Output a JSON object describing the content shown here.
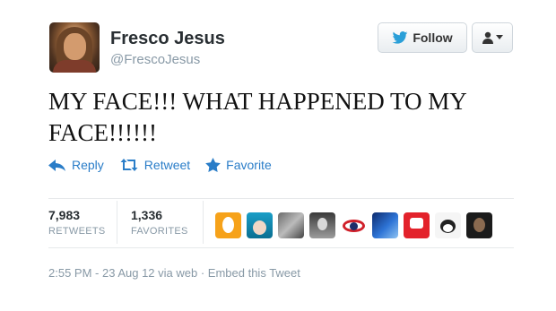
{
  "author": {
    "display_name": "Fresco Jesus",
    "username": "@FrescoJesus"
  },
  "follow_button": {
    "label": "Follow",
    "icon": "twitter-bird-icon"
  },
  "user_menu": {
    "icon": "user-icon"
  },
  "tweet": {
    "line1": "MY FACE!!! WHAT HAPPENED TO MY",
    "line2": "FACE!!!!!!"
  },
  "actions": {
    "reply": "Reply",
    "retweet": "Retweet",
    "favorite": "Favorite"
  },
  "stats": {
    "retweets": {
      "count": "7,983",
      "label": "RETWEETS"
    },
    "favorites": {
      "count": "1,336",
      "label": "FAVORITES"
    }
  },
  "favoriter_avatars": [
    {
      "icon": "egg-avatar"
    },
    {
      "icon": "anime-girl-avatar"
    },
    {
      "icon": "wolf-avatar"
    },
    {
      "icon": "portrait-avatar"
    },
    {
      "icon": "eye-avatar"
    },
    {
      "icon": "blue-abstract-avatar"
    },
    {
      "icon": "red-character-avatar"
    },
    {
      "icon": "cat-avatar"
    },
    {
      "icon": "dark-face-avatar"
    }
  ],
  "meta": {
    "timestamp": "2:55 PM - 23 Aug 12",
    "via": " via web · ",
    "embed": "Embed this Tweet"
  },
  "colors": {
    "link": "#2a7dc8",
    "muted": "#8899a6",
    "text": "#292f33"
  }
}
